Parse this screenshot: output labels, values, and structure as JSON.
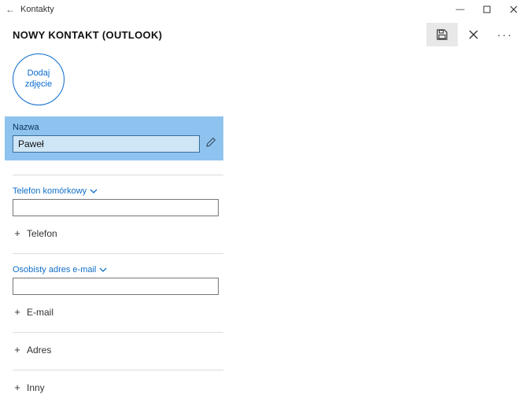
{
  "titlebar": {
    "app_title": "Kontakty",
    "back_glyph": "←",
    "min_glyph": "—"
  },
  "header": {
    "title": "NOWY KONTAKT (OUTLOOK)",
    "more_glyph": "···"
  },
  "photo": {
    "label": "Dodaj zdjęcie"
  },
  "name": {
    "label": "Nazwa",
    "value": "Paweł"
  },
  "phone": {
    "label": "Telefon komórkowy",
    "value": "",
    "add_label": "Telefon"
  },
  "email": {
    "label": "Osobisty adres e-mail",
    "value": "",
    "add_label": "E-mail"
  },
  "address": {
    "add_label": "Adres"
  },
  "other": {
    "add_label": "Inny"
  },
  "glyphs": {
    "plus": "+"
  }
}
